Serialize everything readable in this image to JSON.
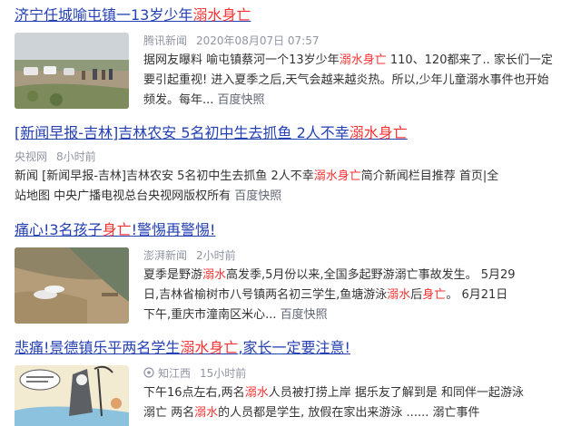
{
  "results": [
    {
      "title_pre": "济宁任城喻屯镇一13岁少年",
      "title_hl": "溺水身亡",
      "title_post": "",
      "source": "腾讯新闻",
      "time": "2020年08月07日 07:57",
      "abstract": [
        {
          "t": "据网友曝料 喻屯镇蔡河一个13岁少年"
        },
        {
          "t": "溺水身亡",
          "hl": true
        },
        {
          "t": " 110、120都来了.. 家长们一定要引起重视! 进入夏季之后,天气会越来越炎热。所以,少年儿童溺水事件也开始频发。每年... "
        }
      ],
      "snapshot": "百度快照"
    },
    {
      "title_pre": "[新闻早报-吉林]吉林农安 5名初中生去抓鱼 2人不幸",
      "title_hl": "溺水身亡",
      "title_post": "",
      "source": "央视网",
      "time": "8小时前",
      "abstract": [
        {
          "t": "新闻 [新闻早报-吉林]吉林农安 5名初中生去抓鱼 2人不幸"
        },
        {
          "t": "溺水身亡",
          "hl": true
        },
        {
          "t": "简介新闻栏目推荐 首页|全站地图 中央广播电视总台央视网版权所有 "
        }
      ],
      "snapshot": "百度快照"
    },
    {
      "title_pre": "痛心!3名孩子",
      "title_hl": "身亡",
      "title_post": "!警惕再警惕!",
      "source": "澎湃新闻",
      "time": "2小时前",
      "abstract": [
        {
          "t": "夏季是野游"
        },
        {
          "t": "溺水",
          "hl": true
        },
        {
          "t": "高发季,5月份以来,全国多起野游溺亡事故发生。 5月29日,吉林省榆树市八号镇两名初三学生,鱼塘游泳"
        },
        {
          "t": "溺水",
          "hl": true
        },
        {
          "t": "后"
        },
        {
          "t": "身亡",
          "hl": true
        },
        {
          "t": "。 6月21日下午,重庆市潼南区米心... "
        }
      ],
      "snapshot": "百度快照"
    },
    {
      "title_pre": "悲痛!景德镇乐平两名学生",
      "title_hl": "溺水身亡",
      "title_post": ",家长一定要注意!",
      "source": "知江西",
      "time": "15小时前",
      "abstract": [
        {
          "t": "下午16点左右,两名"
        },
        {
          "t": "溺水",
          "hl": true
        },
        {
          "t": "人员被打捞上岸 据乐友了解到是 和同伴一起游泳溺亡 两名"
        },
        {
          "t": "溺水",
          "hl": true
        },
        {
          "t": "的人员都是学生, 放假在家出来游泳 ...... 溺亡事件"
        }
      ],
      "snapshot": ""
    }
  ]
}
